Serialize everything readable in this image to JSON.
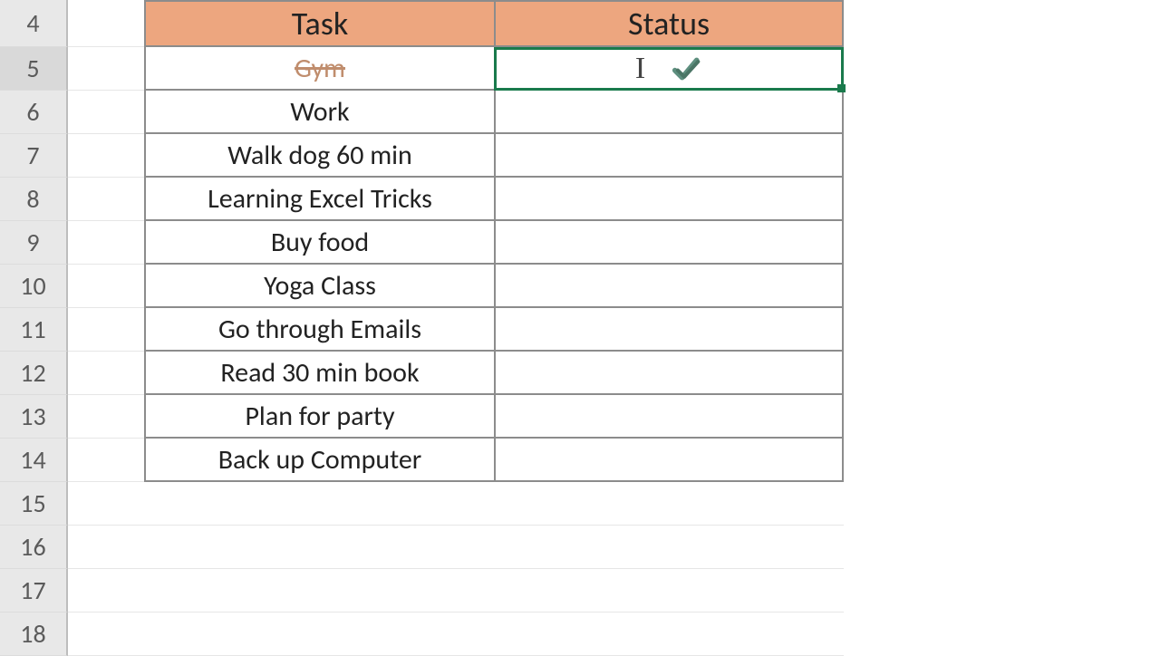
{
  "row_headers": [
    "4",
    "5",
    "6",
    "7",
    "8",
    "9",
    "10",
    "11",
    "12",
    "13",
    "14",
    "15",
    "16",
    "17",
    "18"
  ],
  "active_row_index": 1,
  "table": {
    "header": {
      "task": "Task",
      "status": "Status"
    },
    "rows": [
      {
        "task": "Gym",
        "status_icon": "checkmark",
        "strike": true,
        "selected": true
      },
      {
        "task": "Work"
      },
      {
        "task": "Walk dog 60 min"
      },
      {
        "task": "Learning Excel Tricks"
      },
      {
        "task": "Buy food"
      },
      {
        "task": "Yoga Class"
      },
      {
        "task": "Go through Emails"
      },
      {
        "task": "Read 30 min book"
      },
      {
        "task": "Plan for party"
      },
      {
        "task": "Back up Computer"
      }
    ]
  },
  "colors": {
    "header_fill": "#eda67f",
    "selection_border": "#1a7a4c",
    "checkmark": "#5e8f7f"
  },
  "cursor": "text-caret"
}
